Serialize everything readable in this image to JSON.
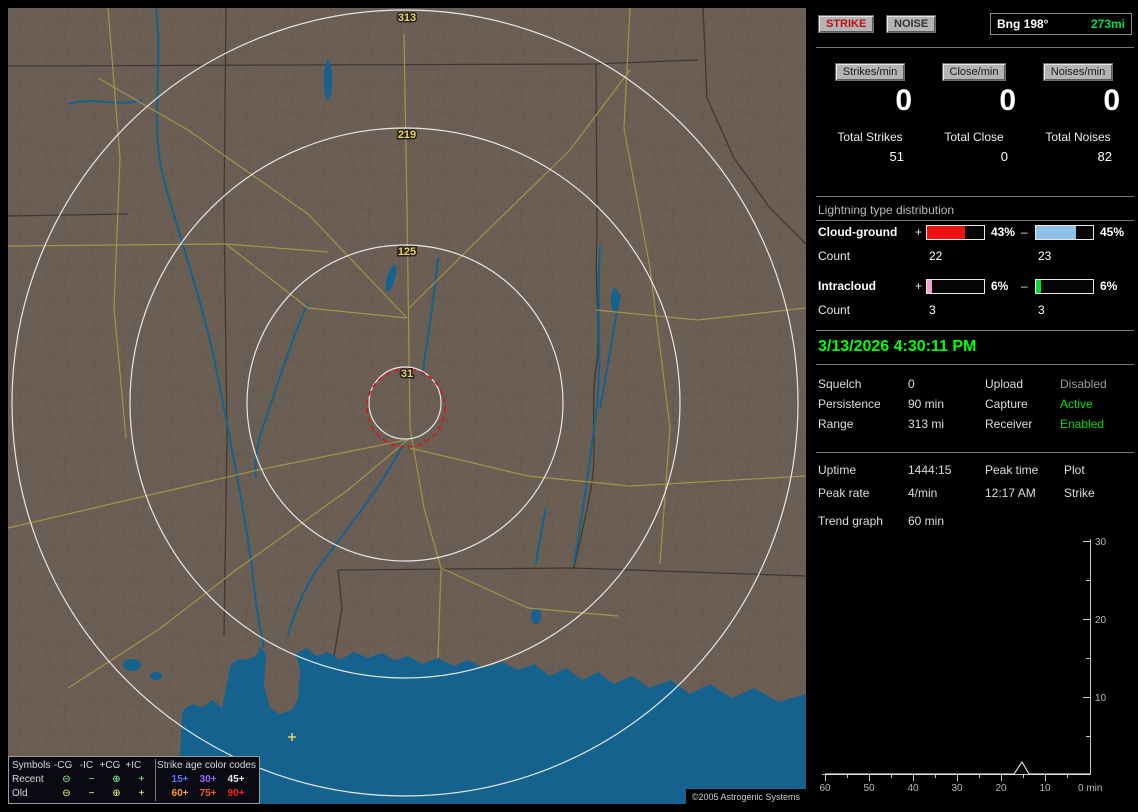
{
  "window": {
    "copyright": "©2005 Astrogenic Systems"
  },
  "map": {
    "ring_labels": [
      "313",
      "219",
      "125",
      "31"
    ],
    "colors": {
      "land": "#6b5e55",
      "water": "#15628e",
      "range_ring": "#eeeeee",
      "alarm_ring": "#dd1111",
      "road": "#a89b45"
    },
    "legend": {
      "symbols_title": "Symbols",
      "symbol_headers": [
        "-CG",
        "-IC",
        "+CG",
        "+IC"
      ],
      "symbol_glyphs": [
        "⊖",
        "−",
        "⊕",
        "+"
      ],
      "recent_label": "Recent",
      "old_label": "Old",
      "age_title": "Strike age color codes",
      "recent_ages": [
        "15+",
        "30+",
        "45+"
      ],
      "recent_age_colors": [
        "#5578ff",
        "#9a66ff",
        "#e8e8e8"
      ],
      "old_ages": [
        "60+",
        "75+",
        "90+"
      ],
      "old_age_colors": [
        "#ffa020",
        "#ff5530",
        "#ff2020"
      ],
      "recent_symbol_color": "#9bff9b",
      "old_symbol_color": "#ffff80"
    }
  },
  "panel": {
    "top": {
      "strike": "STRIKE",
      "noise": "NOISE",
      "bearing": "Bng 198°",
      "distance": "273mi",
      "strike_color": "#c01010",
      "distance_color": "#00dd44"
    },
    "counters": [
      {
        "label": "Strikes/min",
        "value": "0",
        "total_label": "Total Strikes",
        "total": "51"
      },
      {
        "label": "Close/min",
        "value": "0",
        "total_label": "Total Close",
        "total": "0"
      },
      {
        "label": "Noises/min",
        "value": "0",
        "total_label": "Total Noises",
        "total": "82"
      }
    ],
    "distribution": {
      "title": "Lightning type distribution",
      "count_label": "Count",
      "plus": "+",
      "minus": "–",
      "rows": [
        {
          "label": "Cloud-ground",
          "pos_pct": 43,
          "pos_pct_label": "43%",
          "pos_color": "#ee1111",
          "pos_count": "22",
          "neg_pct": 45,
          "neg_pct_label": "45%",
          "neg_color": "#8fc1e8",
          "neg_count": "23"
        },
        {
          "label": "Intracloud",
          "pos_pct": 6,
          "pos_pct_label": "6%",
          "pos_color": "#f2a0cf",
          "pos_count": "3",
          "neg_pct": 6,
          "neg_pct_label": "6%",
          "neg_color": "#00dd33",
          "neg_count": "3"
        }
      ]
    },
    "datetime": "3/13/2026 4:30:11 PM",
    "datetime_color": "#00ff00",
    "settings_rows": [
      {
        "l1": "Squelch",
        "v1": "0",
        "l2": "Upload",
        "v2": "Disabled",
        "v2_color": "#9a9a9a"
      },
      {
        "l1": "Persistence",
        "v1": "90 min",
        "l2": "Capture",
        "v2": "Active",
        "v2_color": "#00dd00"
      },
      {
        "l1": "Range",
        "v1": "313 mi",
        "l2": "Receiver",
        "v2": "Enabled",
        "v2_color": "#00dd00"
      }
    ],
    "stats": {
      "uptime_label": "Uptime",
      "uptime_value": "1444:15",
      "peak_time_label": "Peak time",
      "peak_time_value": "12:17 AM",
      "plot_label": "Plot",
      "plot_value": "Strike",
      "peak_rate_label": "Peak rate",
      "peak_rate_value": "4/min"
    },
    "trend": {
      "label": "Trend graph",
      "range": "60 min",
      "chart_data": {
        "type": "line",
        "title": "Strike rate trend",
        "xlabel": "min",
        "x_ticks": [
          "60",
          "50",
          "40",
          "30",
          "20",
          "10"
        ],
        "x_end_label": "0 min",
        "y_ticks": [
          "30",
          "20",
          "10"
        ],
        "ylim": [
          0,
          30
        ],
        "xlim_minutes_ago": [
          60,
          0
        ],
        "series": [
          {
            "name": "Strike",
            "points_minutes_ago": [
              60,
              17,
              16,
              15,
              0
            ],
            "values": [
              0,
              0,
              2,
              0,
              0
            ]
          }
        ]
      }
    }
  }
}
